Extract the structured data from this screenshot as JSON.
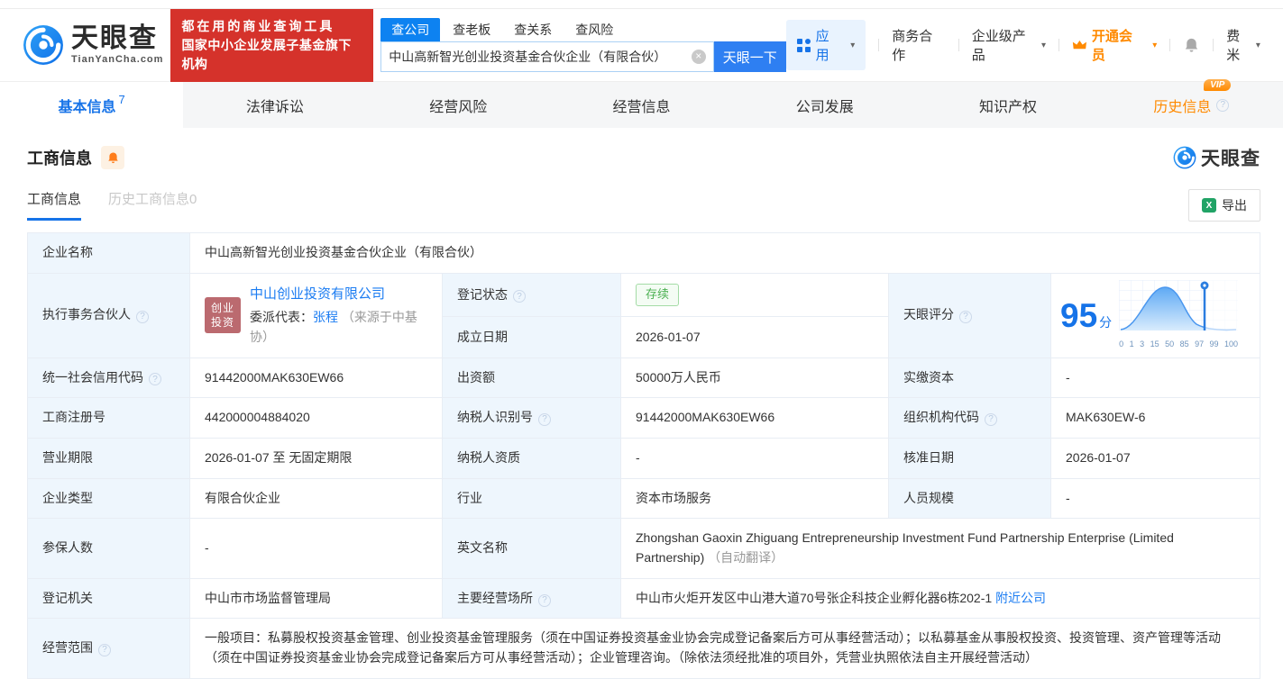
{
  "brand": {
    "name": "天眼查",
    "domain": "TianYanCha.com",
    "slogan_line1": "都在用的商业查询工具",
    "slogan_line2": "国家中小企业发展子基金旗下机构"
  },
  "search": {
    "tabs": [
      "查公司",
      "查老板",
      "查关系",
      "查风险"
    ],
    "value": "中山高新智光创业投资基金合伙企业（有限合伙）",
    "button": "天眼一下"
  },
  "topnav": {
    "apps": "应用",
    "cooperation": "商务合作",
    "enterprise": "企业级产品",
    "vip": "开通会员",
    "user": "费米"
  },
  "tabs": {
    "basic": "基本信息",
    "basic_count": "7",
    "legal": "法律诉讼",
    "risk": "经营风险",
    "operation": "经营信息",
    "development": "公司发展",
    "ip": "知识产权",
    "history": "历史信息",
    "history_vip": "VIP"
  },
  "section": {
    "title": "工商信息",
    "subtab_active": "工商信息",
    "subtab_history": "历史工商信息0",
    "export": "导出",
    "watermark": "天眼查"
  },
  "table": {
    "company_name": {
      "label": "企业名称",
      "value": "中山高新智光创业投资基金合伙企业（有限合伙）"
    },
    "managing_partner": {
      "label": "执行事务合伙人",
      "logo_line1": "创业",
      "logo_line2": "投资",
      "company": "中山创业投资有限公司",
      "rep_label": "委派代表：",
      "rep_name": "张程",
      "rep_source": "（来源于中基协）"
    },
    "reg_status": {
      "label": "登记状态",
      "value": "存续"
    },
    "establish_date": {
      "label": "成立日期",
      "value": "2026-01-07"
    },
    "score": {
      "label": "天眼评分",
      "value": "95",
      "unit": "分",
      "ticks": [
        "0",
        "1",
        "3",
        "15",
        "50",
        "85",
        "97",
        "99",
        "100"
      ]
    },
    "credit_code": {
      "label": "统一社会信用代码",
      "value": "91442000MAK630EW66"
    },
    "contribution": {
      "label": "出资额",
      "value": "50000万人民币"
    },
    "paid_capital": {
      "label": "实缴资本",
      "value": "-"
    },
    "reg_number": {
      "label": "工商注册号",
      "value": "442000004884020"
    },
    "taxpayer_id": {
      "label": "纳税人识别号",
      "value": "91442000MAK630EW66"
    },
    "org_code": {
      "label": "组织机构代码",
      "value": "MAK630EW-6"
    },
    "business_term": {
      "label": "营业期限",
      "value": "2026-01-07 至 无固定期限"
    },
    "taxpayer_quality": {
      "label": "纳税人资质",
      "value": "-"
    },
    "approval_date": {
      "label": "核准日期",
      "value": "2026-01-07"
    },
    "company_type": {
      "label": "企业类型",
      "value": "有限合伙企业"
    },
    "industry": {
      "label": "行业",
      "value": "资本市场服务"
    },
    "staff_size": {
      "label": "人员规模",
      "value": "-"
    },
    "insured_count": {
      "label": "参保人数",
      "value": "-"
    },
    "english_name": {
      "label": "英文名称",
      "value": "Zhongshan Gaoxin Zhiguang Entrepreneurship Investment Fund Partnership Enterprise (Limited Partnership)",
      "note": "（自动翻译）"
    },
    "reg_authority": {
      "label": "登记机关",
      "value": "中山市市场监督管理局"
    },
    "business_address": {
      "label": "主要经营场所",
      "value": "中山市火炬开发区中山港大道70号张企科技企业孵化器6栋202-1",
      "link": "附近公司"
    },
    "business_scope": {
      "label": "经营范围",
      "value": "一般项目：私募股权投资基金管理、创业投资基金管理服务（须在中国证券投资基金业协会完成登记备案后方可从事经营活动）；以私募基金从事股权投资、投资管理、资产管理等活动（须在中国证券投资基金业协会完成登记备案后方可从事经营活动）；企业管理咨询。（除依法须经批准的项目外，凭营业执照依法自主开展经营活动）"
    }
  },
  "icons": {
    "help": "?",
    "caret": "▾",
    "clear": "×",
    "excel": "X"
  },
  "colors": {
    "brand_blue": "#1673e8",
    "banner_red": "#d5322b",
    "vip_orange": "#ff8a00",
    "status_green": "#4cb052",
    "link_blue": "#1b7cf2",
    "label_bg": "#eef6fd",
    "partner_logo_bg": "#bb6a6f"
  }
}
